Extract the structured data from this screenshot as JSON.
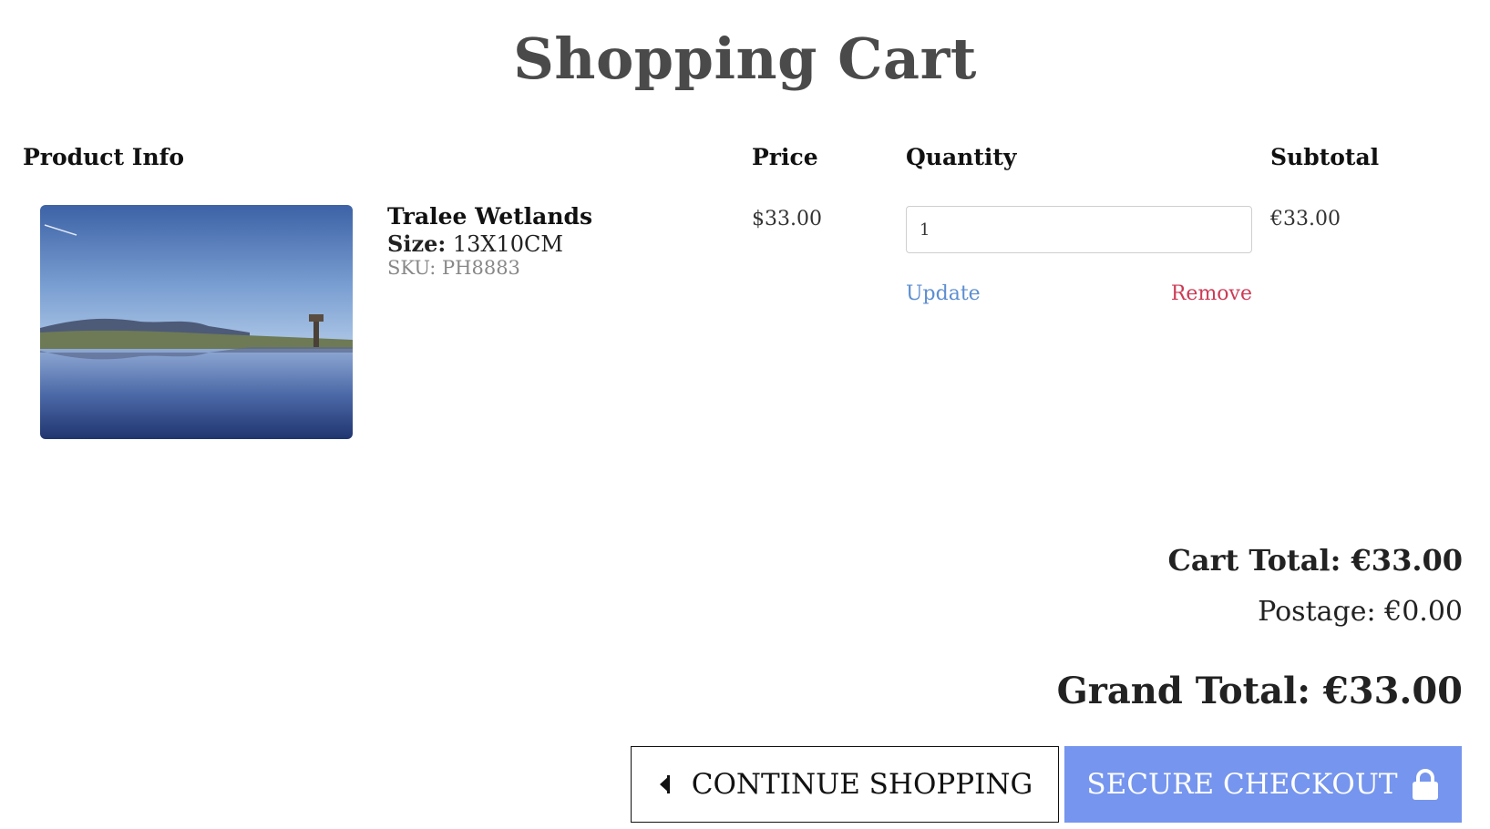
{
  "page": {
    "title": "Shopping Cart"
  },
  "table": {
    "headers": {
      "product_info": "Product Info",
      "price": "Price",
      "quantity": "Quantity",
      "subtotal": "Subtotal"
    }
  },
  "items": [
    {
      "name": "Tralee Wetlands",
      "size_label": "Size:",
      "size_value": "13X10CM",
      "sku": "SKU: PH8883",
      "price": "$33.00",
      "quantity": "1",
      "subtotal": "€33.00",
      "update_label": "Update",
      "remove_label": "Remove"
    }
  ],
  "totals": {
    "cart_total": "Cart Total: €33.00",
    "postage": "Postage: €0.00",
    "grand_total": "Grand Total: €33.00"
  },
  "buttons": {
    "continue_label": "CONTINUE SHOPPING",
    "checkout_label": "SECURE CHECKOUT"
  },
  "icons": {
    "continue": "caret-left-icon",
    "checkout": "lock-icon"
  },
  "colors": {
    "update_link": "#5d8ed0",
    "remove_link": "#cc3b55",
    "checkout_bg": "#7595ee"
  }
}
